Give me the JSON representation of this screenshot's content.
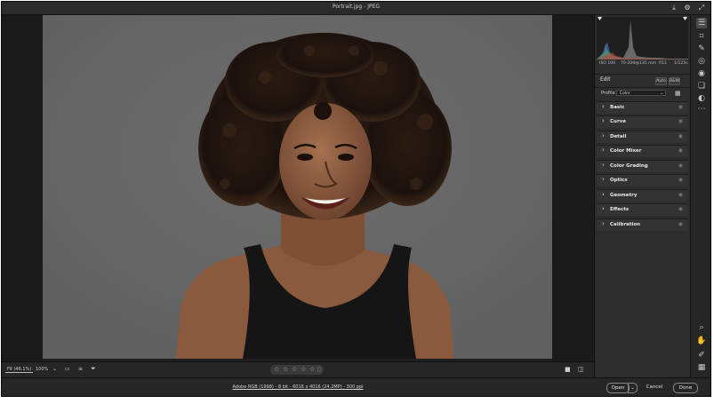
{
  "window": {
    "title": "Portrait.jpg  -  JPEG"
  },
  "histogram": {
    "exif": {
      "iso": "ISO 100",
      "lens": "70-200@135 mm",
      "aperture": "f/11",
      "shutter": "1/125s"
    }
  },
  "edit": {
    "title": "Edit",
    "auto_label": "Auto",
    "bw_label": "B&W"
  },
  "profile": {
    "label": "Profile",
    "value": "Color"
  },
  "panels": [
    {
      "label": "Basic"
    },
    {
      "label": "Curve"
    },
    {
      "label": "Detail"
    },
    {
      "label": "Color Mixer"
    },
    {
      "label": "Color Grading"
    },
    {
      "label": "Optics"
    },
    {
      "label": "Geometry"
    },
    {
      "label": "Effects"
    },
    {
      "label": "Calibration"
    }
  ],
  "footer": {
    "fit_label": "Fit (46.1%)",
    "zoom_label": "100%",
    "info": "Adobe RGB (1998) - 8 bit - 6016 x 4016 (24.2MP) - 300 ppi"
  },
  "buttons": {
    "open": "Open",
    "cancel": "Cancel",
    "done": "Done"
  },
  "icons": {
    "titlebar": [
      "save-icon",
      "gear-icon",
      "fullscreen-icon"
    ],
    "tools": [
      "edit-sliders-icon",
      "crop-icon",
      "healing-icon",
      "mask-icon",
      "redeye-icon",
      "presets-icon",
      "snapshots-icon",
      "more-icon",
      "zoom-icon",
      "hand-icon",
      "color-sampler-icon",
      "grid-overlay-icon"
    ]
  },
  "colors": {
    "accent_button": "#e9e9e9",
    "panel_bg": "#2d2d2d",
    "canvas_bg": "#666666"
  }
}
